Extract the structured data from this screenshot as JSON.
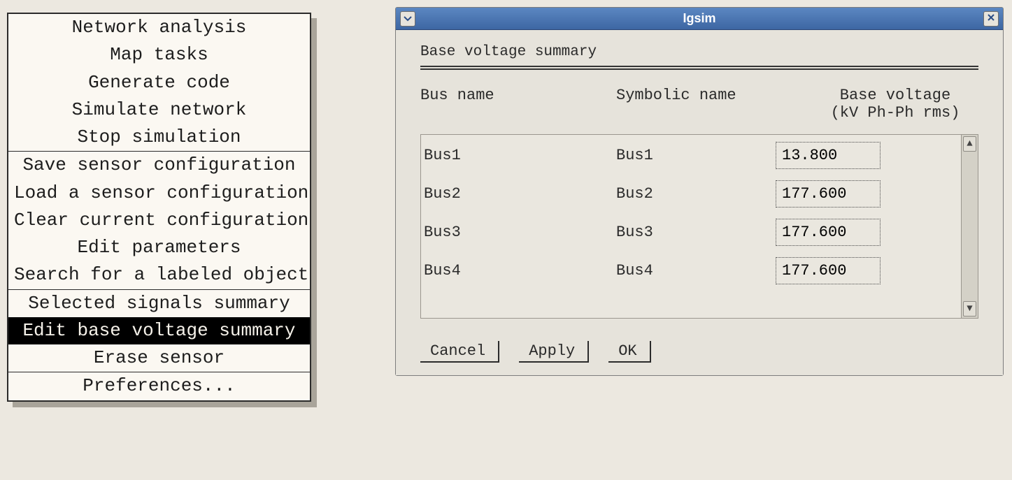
{
  "menu": {
    "groups": [
      {
        "items": [
          {
            "label": "Network analysis"
          },
          {
            "label": "Map tasks"
          },
          {
            "label": "Generate code"
          },
          {
            "label": "Simulate network"
          },
          {
            "label": "Stop simulation"
          }
        ]
      },
      {
        "items": [
          {
            "label": "Save sensor configuration"
          },
          {
            "label": "Load a sensor configuration"
          },
          {
            "label": "Clear current configuration"
          },
          {
            "label": "Edit parameters"
          },
          {
            "label": "Search for a labeled object"
          }
        ]
      },
      {
        "items": [
          {
            "label": "Selected signals summary"
          },
          {
            "label": "Edit base voltage summary",
            "highlight": true
          },
          {
            "label": "Erase sensor"
          }
        ]
      },
      {
        "items": [
          {
            "label": "Preferences..."
          }
        ]
      }
    ]
  },
  "dialog": {
    "window_title": "Igsim",
    "section_title": "Base voltage summary",
    "columns": {
      "bus_name": "Bus name",
      "symbolic_name": "Symbolic name",
      "base_voltage_line1": "Base voltage",
      "base_voltage_line2": "(kV Ph-Ph rms)"
    },
    "rows": [
      {
        "bus_name": "Bus1",
        "symbolic_name": "Bus1",
        "voltage": "13.800"
      },
      {
        "bus_name": "Bus2",
        "symbolic_name": "Bus2",
        "voltage": "177.600"
      },
      {
        "bus_name": "Bus3",
        "symbolic_name": "Bus3",
        "voltage": "177.600"
      },
      {
        "bus_name": "Bus4",
        "symbolic_name": "Bus4",
        "voltage": "177.600"
      }
    ],
    "buttons": {
      "cancel": "Cancel",
      "apply": "Apply",
      "ok": "OK"
    }
  }
}
